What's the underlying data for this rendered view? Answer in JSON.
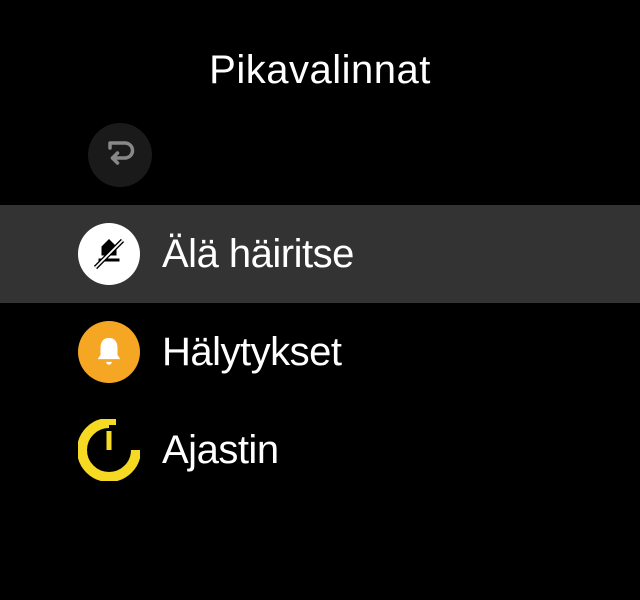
{
  "header": {
    "title": "Pikavalinnat"
  },
  "menu": {
    "items": [
      {
        "label": "Älä häiritse",
        "icon": "do-not-disturb-icon",
        "selected": true
      },
      {
        "label": "Hälytykset",
        "icon": "bell-icon",
        "selected": false
      },
      {
        "label": "Ajastin",
        "icon": "timer-icon",
        "selected": false
      }
    ]
  },
  "colors": {
    "background": "#000000",
    "selected": "#333333",
    "amber": "#f5a623",
    "white": "#ffffff"
  }
}
